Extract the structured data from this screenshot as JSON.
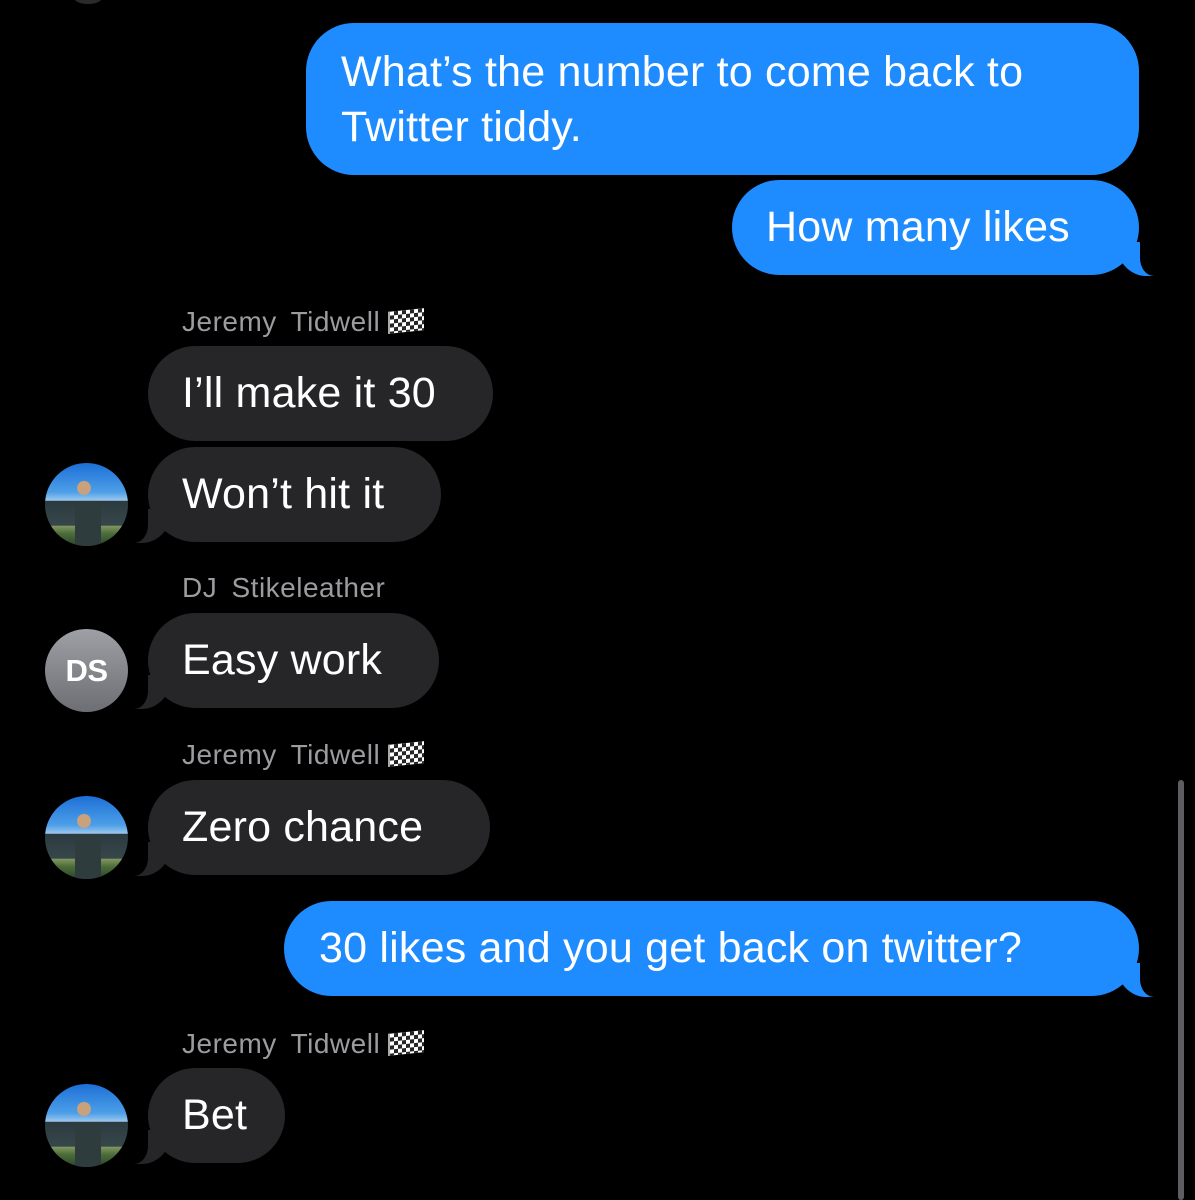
{
  "conversation": {
    "messages": [
      {
        "id": "m1",
        "direction": "outgoing",
        "lines": [
          "What’s the number to come back to",
          "Twitter tiddy."
        ]
      },
      {
        "id": "m2",
        "direction": "outgoing",
        "lines": [
          "How many likes"
        ]
      },
      {
        "id": "m3",
        "direction": "incoming",
        "sender": "Jeremy  Tidwell",
        "sender_emoji": "checkered-flag",
        "lines": [
          "I’ll make it 30"
        ]
      },
      {
        "id": "m4",
        "direction": "incoming",
        "avatar": "photo",
        "lines": [
          "Won’t hit it"
        ]
      },
      {
        "id": "m5",
        "direction": "incoming",
        "sender": "DJ Stikeleather",
        "avatar": "initials",
        "avatar_initials": "DS",
        "lines": [
          "Easy work"
        ]
      },
      {
        "id": "m6",
        "direction": "incoming",
        "sender": "Jeremy  Tidwell",
        "sender_emoji": "checkered-flag",
        "avatar": "photo",
        "lines": [
          "Zero chance"
        ]
      },
      {
        "id": "m7",
        "direction": "outgoing",
        "lines": [
          "30 likes and you get back on twitter?"
        ]
      },
      {
        "id": "m8",
        "direction": "incoming",
        "sender": "Jeremy  Tidwell",
        "sender_emoji": "checkered-flag",
        "avatar": "photo",
        "lines": [
          "Bet"
        ]
      }
    ]
  },
  "colors": {
    "background": "#000000",
    "outgoing_bubble": "#1e8cff",
    "incoming_bubble": "#262628",
    "sender_name": "#9b9ba0"
  }
}
